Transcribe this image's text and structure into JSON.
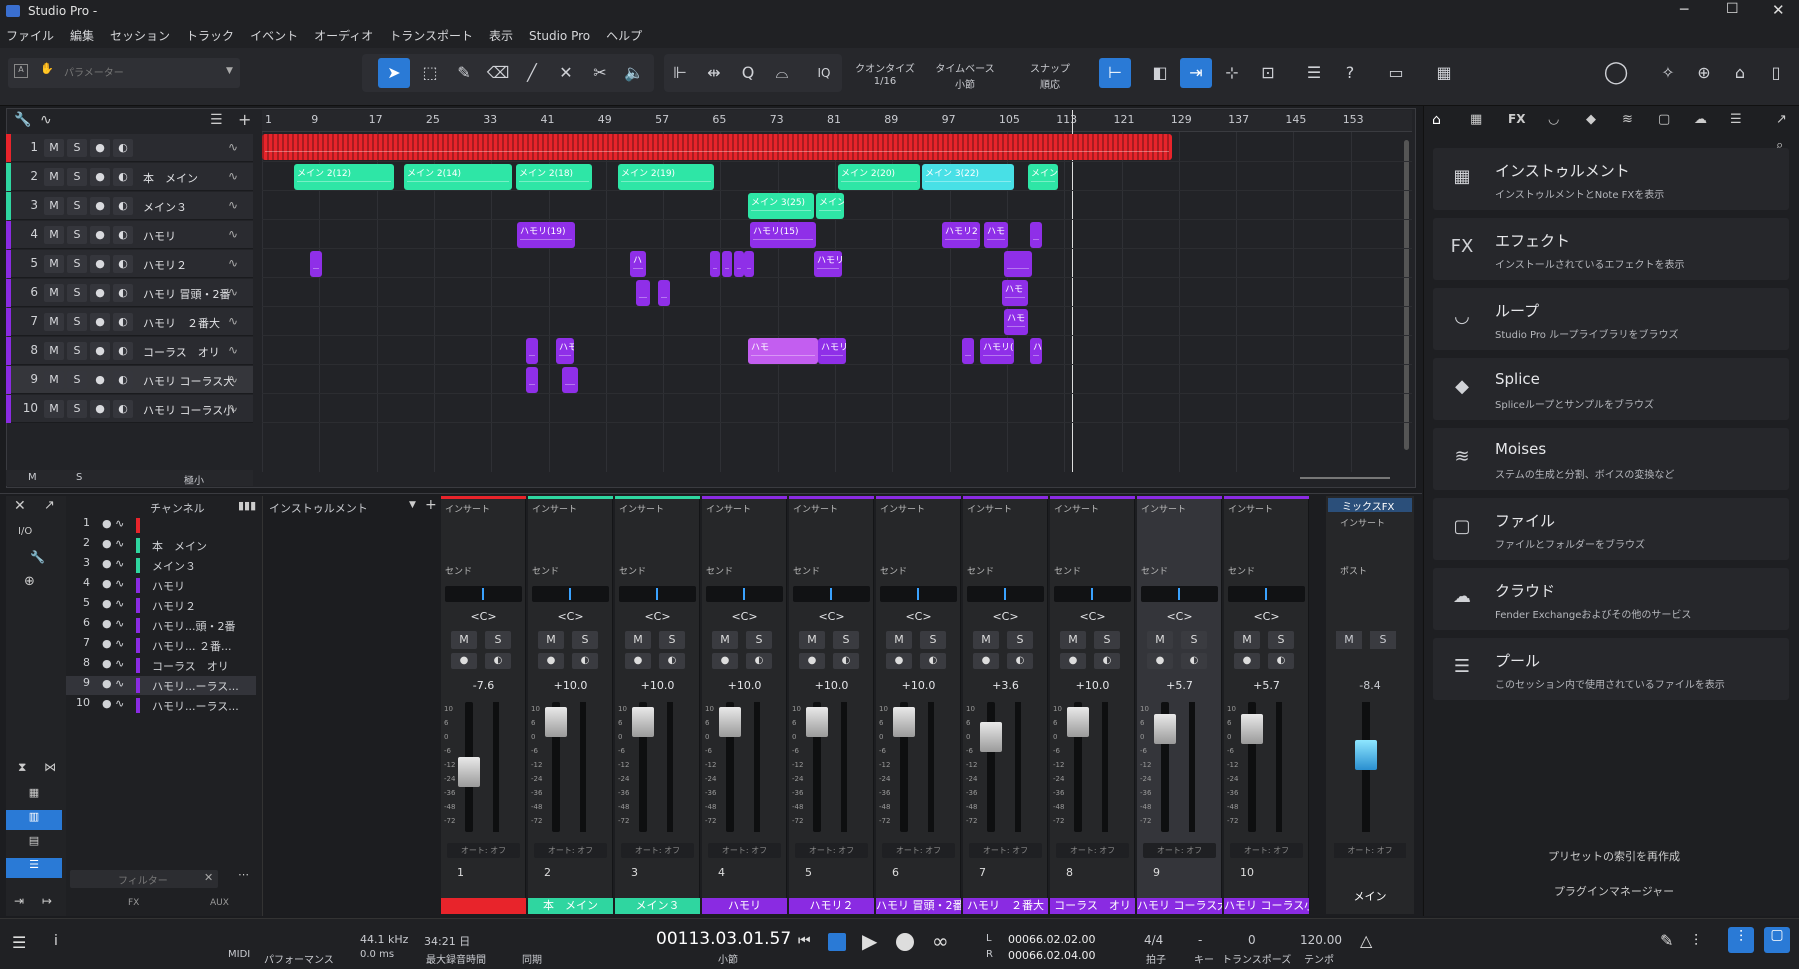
{
  "app": {
    "title": "Studio Pro -"
  },
  "menu": [
    "ファイル",
    "編集",
    "セッション",
    "トラック",
    "イベント",
    "オーディオ",
    "トランスポート",
    "表示",
    "Studio Pro",
    "ヘルプ"
  ],
  "toolbar": {
    "param_placeholder": "パラメーター",
    "quantize_label": "クオンタイズ",
    "quantize_value": "1/16",
    "timebase_label": "タイムベース",
    "timebase_value": "小節",
    "snap_label": "スナップ",
    "snap_value": "順応",
    "iq": "IQ"
  },
  "ruler": [
    "1",
    "9",
    "17",
    "25",
    "33",
    "41",
    "49",
    "57",
    "65",
    "73",
    "81",
    "89",
    "97",
    "105",
    "113",
    "121",
    "129",
    "137",
    "145",
    "153"
  ],
  "tracks": [
    {
      "num": "1",
      "name": "",
      "color": "#e8242b"
    },
    {
      "num": "2",
      "name": "本　メイン",
      "color": "#2fd6a0"
    },
    {
      "num": "3",
      "name": "メイン３",
      "color": "#2fd6a0"
    },
    {
      "num": "4",
      "name": "ハモリ",
      "color": "#8a2be2"
    },
    {
      "num": "5",
      "name": "ハモリ２",
      "color": "#8a2be2"
    },
    {
      "num": "6",
      "name": "ハモリ 冒頭・2番",
      "color": "#8a2be2"
    },
    {
      "num": "7",
      "name": "ハモリ　２番大",
      "color": "#8a2be2"
    },
    {
      "num": "8",
      "name": "コーラス　オリ",
      "color": "#8a2be2"
    },
    {
      "num": "9",
      "name": "ハモリ コーラス大",
      "color": "#8a2be2"
    },
    {
      "num": "10",
      "name": "ハモリ コーラス小",
      "color": "#8a2be2"
    }
  ],
  "clips": {
    "c1": "メイン 2(12)",
    "c2": "メイン 2(14)",
    "c3": "メイン 2(18)",
    "c4": "メイン 2(19)",
    "c5": "メイン 2(20)",
    "c6": "メイン 3(22)",
    "c7": "メイン",
    "c8": "メイン 3(25)",
    "c9": "メイン",
    "c10": "ハモリ(19)",
    "c11": "ハモリ(15)",
    "c12": "ハモリ2",
    "c13": "ハモ",
    "c14": "ハ",
    "c15": "ハモリ",
    "c16": "ハモ",
    "c17": "ハモ",
    "c18": "ハモ",
    "c19": "ハモ",
    "c20": "ハモリ",
    "c21": "ハモリ(C",
    "c22": "ハ"
  },
  "track_footer": {
    "m": "M",
    "s": "S",
    "size": "極小"
  },
  "channel_list": {
    "header": "チャンネル",
    "inst": "インストゥルメント",
    "items": [
      "",
      "本　メイン",
      "メイン３",
      "ハモリ",
      "ハモリ２",
      "ハモリ...頭・2番",
      "ハモリ... ２番...",
      "コーラス　オリ",
      "ハモリ...ーラス...",
      "ハモリ...ーラス..."
    ],
    "filter": "フィルター",
    "io": "I/O",
    "aux": "AUX",
    "fx": "FX"
  },
  "strips": [
    {
      "num": "1",
      "label": "",
      "db": "-7.6",
      "color": "#e8242b",
      "fader": 0.55
    },
    {
      "num": "2",
      "label": "本　メイン",
      "db": "+10.0",
      "color": "#2fd6a0",
      "fader": 0.05
    },
    {
      "num": "3",
      "label": "メイン３",
      "db": "+10.0",
      "color": "#2fd6a0",
      "fader": 0.05
    },
    {
      "num": "4",
      "label": "ハモリ",
      "db": "+10.0",
      "color": "#8a2be2",
      "fader": 0.05
    },
    {
      "num": "5",
      "label": "ハモリ２",
      "db": "+10.0",
      "color": "#8a2be2",
      "fader": 0.05
    },
    {
      "num": "6",
      "label": "ハモリ 冒頭・2番",
      "db": "+10.0",
      "color": "#8a2be2",
      "fader": 0.05
    },
    {
      "num": "7",
      "label": "ハモリ　２番大",
      "db": "+3.6",
      "color": "#8a2be2",
      "fader": 0.2
    },
    {
      "num": "8",
      "label": "コーラス　オリ",
      "db": "+10.0",
      "color": "#8a2be2",
      "fader": 0.05
    },
    {
      "num": "9",
      "label": "ハモリ コーラス大",
      "db": "+5.7",
      "color": "#8a2be2",
      "fader": 0.12
    },
    {
      "num": "10",
      "label": "ハモリ コーラス小",
      "db": "+5.7",
      "color": "#8a2be2",
      "fader": 0.12
    }
  ],
  "strip_common": {
    "insert": "インサート",
    "send": "センド",
    "post": "ポスト",
    "center": "<C>",
    "m": "M",
    "s": "S",
    "auto": "オート: オフ"
  },
  "main": {
    "label": "メイン",
    "db": "-8.4",
    "mixfx": "ミックスFX"
  },
  "browser": {
    "items": [
      {
        "title": "インストゥルメント",
        "desc": "インストゥルメントとNote FXを表示",
        "icon": "▦"
      },
      {
        "title": "エフェクト",
        "desc": "インストールされているエフェクトを表示",
        "icon": "FX"
      },
      {
        "title": "ループ",
        "desc": "Studio Pro ループライブラリをブラウズ",
        "icon": "◡"
      },
      {
        "title": "Splice",
        "desc": "Spliceループとサンプルをブラウズ",
        "icon": "◆"
      },
      {
        "title": "Moises",
        "desc": "ステムの生成と分割、ボイスの変換など",
        "icon": "≋"
      },
      {
        "title": "ファイル",
        "desc": "ファイルとフォルダーをブラウズ",
        "icon": "▢"
      },
      {
        "title": "クラウド",
        "desc": "Fender Exchangeおよびその他のサービス",
        "icon": "☁"
      },
      {
        "title": "プール",
        "desc": "このセッション内で使用されているファイルを表示",
        "icon": "☰"
      }
    ],
    "reindex": "プリセットの索引を再作成",
    "plugin_manager": "プラグインマネージャー"
  },
  "status": {
    "midi": "MIDI",
    "perf": "パフォーマンス",
    "rate": "44.1 kHz",
    "latency": "0.0 ms",
    "rec_time": "34:21 日",
    "rec_label": "最大録音時間",
    "sync": "同期",
    "position": "00113.03.01.57",
    "position_unit": "小節",
    "l_pos": "00066.02.02.00",
    "r_pos": "00066.02.04.00",
    "l": "L",
    "r": "R",
    "sig": "4/4",
    "sig_lbl": "拍子",
    "key": "-",
    "key_lbl": "キー",
    "trans": "0",
    "trans_lbl": "トランスポーズ",
    "tempo": "120.00",
    "tempo_lbl": "テンポ"
  }
}
